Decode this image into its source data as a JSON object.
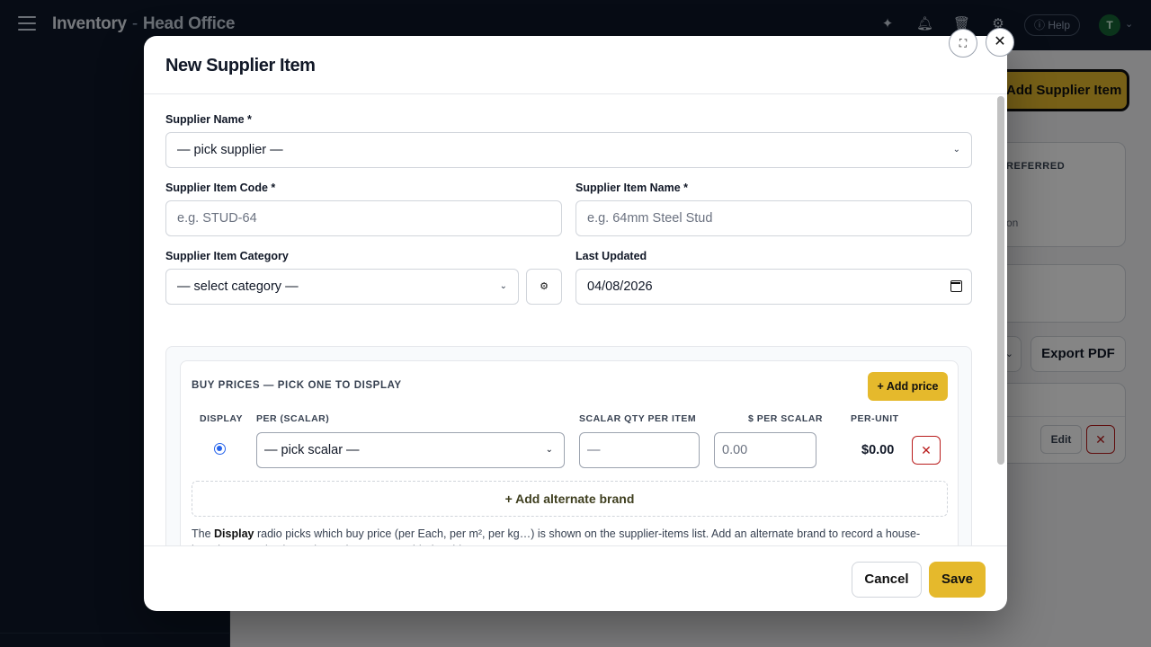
{
  "app": {
    "title": "Inventory",
    "separator": "-",
    "location": "Head Office",
    "help_label": "Help",
    "avatar_initial": "T"
  },
  "background": {
    "add_button_label": "Add Supplier Item",
    "card_heading": "REFERRED",
    "card_text": "on",
    "export_label": "Export PDF",
    "edit_label": "Edit"
  },
  "modal": {
    "title": "New Supplier Item",
    "fields": {
      "supplier_name": {
        "label": "Supplier Name *",
        "value": "— pick supplier —"
      },
      "supplier_item_code": {
        "label": "Supplier Item Code *",
        "placeholder": "e.g. STUD-64"
      },
      "supplier_item_name": {
        "label": "Supplier Item Name *",
        "placeholder": "e.g. 64mm Steel Stud"
      },
      "supplier_item_category": {
        "label": "Supplier Item Category",
        "value": "— select category —"
      },
      "last_updated": {
        "label": "Last Updated",
        "value": "04/08/2026"
      }
    },
    "buy_prices": {
      "title": "BUY PRICES — PICK ONE TO DISPLAY",
      "add_price_label": "+ Add price",
      "columns": {
        "display": "DISPLAY",
        "per_scalar": "PER (SCALAR)",
        "scalar_qty": "SCALAR QTY PER ITEM",
        "dollar_per_scalar": "$ PER SCALAR",
        "per_unit": "PER-UNIT"
      },
      "rows": [
        {
          "scalar": "— pick scalar —",
          "qty_placeholder": "—",
          "price_placeholder": "0.00",
          "per_unit": "$0.00",
          "selected": true
        }
      ],
      "add_alt_brand_label": "+ Add alternate brand",
      "help": {
        "prefix": "The ",
        "bold": "Display",
        "suffix": " radio picks which buy price (per Each, per m², per kg…) is shown on the supplier-items list. Add an alternate brand to record a house-brand or generic alternative — it compares side-by-side."
      }
    },
    "cancel_label": "Cancel",
    "save_label": "Save"
  }
}
